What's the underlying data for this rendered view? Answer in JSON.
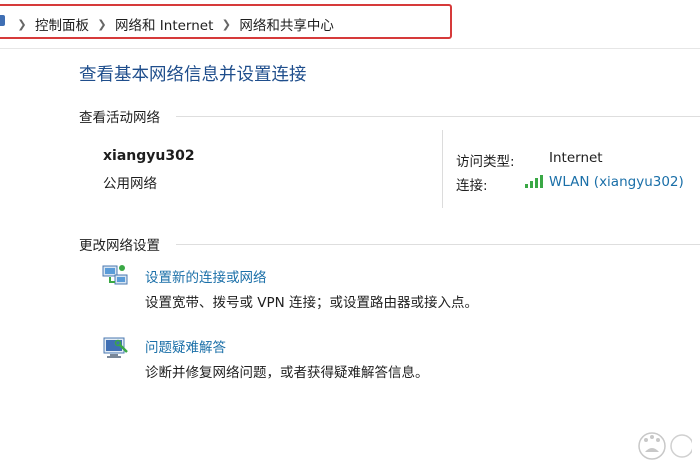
{
  "breadcrumb": {
    "items": [
      "控制面板",
      "网络和 Internet",
      "网络和共享中心"
    ]
  },
  "page_title": "查看基本网络信息并设置连接",
  "active_networks": {
    "header": "查看活动网络",
    "network_name": "xiangyu302",
    "network_type": "公用网络",
    "access_type_label": "访问类型:",
    "access_type_value": "Internet",
    "connection_label": "连接:",
    "connection_value": "WLAN (xiangyu302)"
  },
  "change_settings": {
    "header": "更改网络设置",
    "tasks": [
      {
        "icon": "network-setup-icon",
        "title": "设置新的连接或网络",
        "description": "设置宽带、拨号或 VPN 连接；或设置路由器或接入点。"
      },
      {
        "icon": "troubleshoot-icon",
        "title": "问题疑难解答",
        "description": "诊断并修复网络问题，或者获得疑难解答信息。"
      }
    ]
  },
  "colors": {
    "accent_link": "#1a6fa8",
    "title_blue": "#1f4e8c",
    "highlight_red": "#d63a3a",
    "signal_green": "#3aa845"
  }
}
